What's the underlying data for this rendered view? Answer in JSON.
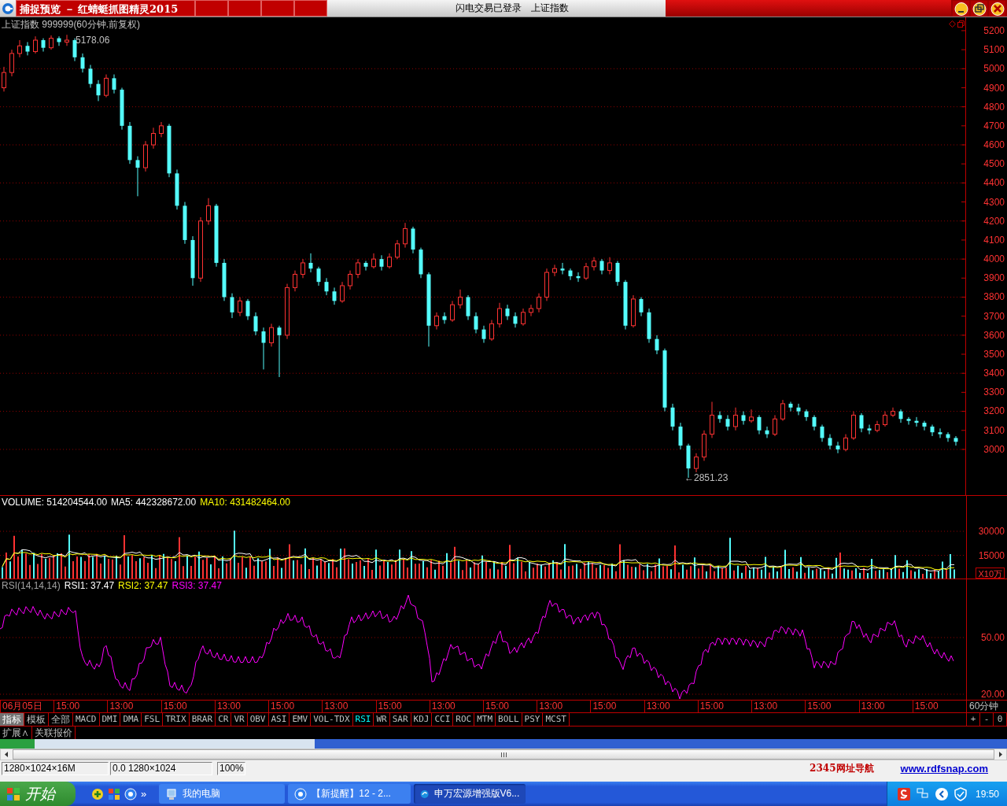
{
  "title_bar": {
    "title": "捕捉预览 － 红蜻蜓抓图精灵2015",
    "status": "闪电交易已登录",
    "symbol": "上证指数"
  },
  "price_panel": {
    "title": "上证指数 999999(60分钟.前复权)",
    "high_label": "5178.06",
    "low_label": "←2851.23",
    "chart_data": {
      "type": "candlestick",
      "ylim": [
        2760,
        5270
      ],
      "grid": true,
      "yticks": [
        {
          "value": 5200,
          "label": "5200"
        },
        {
          "value": 5100,
          "label": "5100"
        },
        {
          "value": 5000,
          "label": "5000"
        },
        {
          "value": 4900,
          "label": "4900"
        },
        {
          "value": 4800,
          "label": "4800"
        },
        {
          "value": 4700,
          "label": "4700"
        },
        {
          "value": 4600,
          "label": "4600"
        },
        {
          "value": 4500,
          "label": "4500"
        },
        {
          "value": 4400,
          "label": "4400"
        },
        {
          "value": 4300,
          "label": "4300"
        },
        {
          "value": 4200,
          "label": "4200"
        },
        {
          "value": 4100,
          "label": "4100"
        },
        {
          "value": 4000,
          "label": "4000"
        },
        {
          "value": 3900,
          "label": "3900"
        },
        {
          "value": 3800,
          "label": "3800"
        },
        {
          "value": 3700,
          "label": "3700"
        },
        {
          "value": 3600,
          "label": "3600"
        },
        {
          "value": 3500,
          "label": "3500"
        },
        {
          "value": 3400,
          "label": "3400"
        },
        {
          "value": 3300,
          "label": "3300"
        },
        {
          "value": 3200,
          "label": "3200"
        },
        {
          "value": 3100,
          "label": "3100"
        },
        {
          "value": 3000,
          "label": "3000"
        }
      ],
      "ohlc": [
        [
          4900,
          5010,
          4880,
          4980
        ],
        [
          4980,
          5100,
          4960,
          5080
        ],
        [
          5080,
          5150,
          5060,
          5120
        ],
        [
          5120,
          5140,
          5070,
          5090
        ],
        [
          5090,
          5170,
          5080,
          5150
        ],
        [
          5150,
          5160,
          5090,
          5110
        ],
        [
          5110,
          5175,
          5100,
          5160
        ],
        [
          5160,
          5170,
          5120,
          5140
        ],
        [
          5140,
          5178.06,
          5120,
          5150
        ],
        [
          5150,
          5160,
          5040,
          5060
        ],
        [
          5060,
          5080,
          4980,
          5000
        ],
        [
          5000,
          5020,
          4900,
          4920
        ],
        [
          4920,
          4940,
          4830,
          4860
        ],
        [
          4860,
          4970,
          4850,
          4950
        ],
        [
          4950,
          4970,
          4870,
          4890
        ],
        [
          4890,
          4900,
          4680,
          4700
        ],
        [
          4700,
          4720,
          4500,
          4520
        ],
        [
          4520,
          4540,
          4330,
          4480
        ],
        [
          4480,
          4620,
          4460,
          4600
        ],
        [
          4600,
          4690,
          4580,
          4660
        ],
        [
          4660,
          4720,
          4640,
          4700
        ],
        [
          4700,
          4710,
          4430,
          4450
        ],
        [
          4450,
          4470,
          4260,
          4280
        ],
        [
          4280,
          4300,
          4080,
          4100
        ],
        [
          4100,
          4120,
          3860,
          3900
        ],
        [
          3900,
          4220,
          3880,
          4200
        ],
        [
          4200,
          4320,
          4180,
          4280
        ],
        [
          4280,
          4290,
          3960,
          3980
        ],
        [
          3980,
          4000,
          3780,
          3800
        ],
        [
          3800,
          3820,
          3690,
          3720
        ],
        [
          3720,
          3800,
          3700,
          3780
        ],
        [
          3780,
          3790,
          3680,
          3700
        ],
        [
          3700,
          3720,
          3600,
          3620
        ],
        [
          3620,
          3640,
          3420,
          3560
        ],
        [
          3560,
          3660,
          3540,
          3640
        ],
        [
          3640,
          3650,
          3380,
          3600
        ],
        [
          3600,
          3870,
          3580,
          3850
        ],
        [
          3850,
          3940,
          3830,
          3920
        ],
        [
          3920,
          4000,
          3900,
          3980
        ],
        [
          3980,
          4030,
          3930,
          3950
        ],
        [
          3950,
          3960,
          3860,
          3880
        ],
        [
          3880,
          3900,
          3810,
          3830
        ],
        [
          3830,
          3850,
          3760,
          3780
        ],
        [
          3780,
          3880,
          3770,
          3860
        ],
        [
          3860,
          3940,
          3840,
          3920
        ],
        [
          3920,
          4000,
          3900,
          3980
        ],
        [
          3980,
          3990,
          3940,
          3960
        ],
        [
          3960,
          4030,
          3950,
          4000
        ],
        [
          4000,
          4020,
          3940,
          3960
        ],
        [
          3960,
          4030,
          3950,
          4010
        ],
        [
          4010,
          4100,
          4000,
          4080
        ],
        [
          4080,
          4190,
          4060,
          4160
        ],
        [
          4160,
          4170,
          4030,
          4050
        ],
        [
          4050,
          4060,
          3900,
          3920
        ],
        [
          3920,
          3930,
          3540,
          3650
        ],
        [
          3650,
          3720,
          3630,
          3700
        ],
        [
          3700,
          3720,
          3660,
          3680
        ],
        [
          3680,
          3780,
          3670,
          3760
        ],
        [
          3760,
          3840,
          3740,
          3800
        ],
        [
          3800,
          3810,
          3680,
          3700
        ],
        [
          3700,
          3720,
          3610,
          3630
        ],
        [
          3630,
          3650,
          3560,
          3580
        ],
        [
          3580,
          3680,
          3570,
          3660
        ],
        [
          3660,
          3770,
          3640,
          3740
        ],
        [
          3740,
          3760,
          3680,
          3700
        ],
        [
          3700,
          3720,
          3640,
          3660
        ],
        [
          3660,
          3740,
          3650,
          3720
        ],
        [
          3720,
          3760,
          3700,
          3740
        ],
        [
          3740,
          3820,
          3720,
          3800
        ],
        [
          3800,
          3950,
          3780,
          3930
        ],
        [
          3930,
          3970,
          3910,
          3950
        ],
        [
          3950,
          3980,
          3920,
          3940
        ],
        [
          3940,
          3950,
          3890,
          3910
        ],
        [
          3910,
          3930,
          3880,
          3900
        ],
        [
          3900,
          3980,
          3890,
          3960
        ],
        [
          3960,
          4010,
          3940,
          3990
        ],
        [
          3990,
          4000,
          3920,
          3940
        ],
        [
          3940,
          4010,
          3920,
          3980
        ],
        [
          3980,
          3990,
          3860,
          3880
        ],
        [
          3880,
          3890,
          3630,
          3650
        ],
        [
          3650,
          3810,
          3640,
          3790
        ],
        [
          3790,
          3800,
          3700,
          3720
        ],
        [
          3720,
          3740,
          3560,
          3580
        ],
        [
          3580,
          3600,
          3500,
          3520
        ],
        [
          3520,
          3530,
          3200,
          3220
        ],
        [
          3220,
          3240,
          3100,
          3120
        ],
        [
          3120,
          3140,
          3000,
          3020
        ],
        [
          3020,
          3030,
          2851.23,
          2900
        ],
        [
          2900,
          2980,
          2880,
          2960
        ],
        [
          2960,
          3100,
          2940,
          3080
        ],
        [
          3080,
          3250,
          3060,
          3180
        ],
        [
          3180,
          3200,
          3140,
          3160
        ],
        [
          3160,
          3180,
          3100,
          3120
        ],
        [
          3120,
          3220,
          3100,
          3180
        ],
        [
          3180,
          3200,
          3130,
          3150
        ],
        [
          3150,
          3210,
          3140,
          3170
        ],
        [
          3170,
          3180,
          3080,
          3100
        ],
        [
          3100,
          3120,
          3060,
          3080
        ],
        [
          3080,
          3180,
          3070,
          3160
        ],
        [
          3160,
          3260,
          3150,
          3240
        ],
        [
          3240,
          3250,
          3200,
          3220
        ],
        [
          3220,
          3240,
          3180,
          3200
        ],
        [
          3200,
          3210,
          3150,
          3170
        ],
        [
          3170,
          3180,
          3100,
          3120
        ],
        [
          3120,
          3130,
          3040,
          3060
        ],
        [
          3060,
          3080,
          3000,
          3020
        ],
        [
          3020,
          3040,
          2980,
          3000
        ],
        [
          3000,
          3080,
          2990,
          3060
        ],
        [
          3060,
          3200,
          3050,
          3180
        ],
        [
          3180,
          3190,
          3090,
          3110
        ],
        [
          3110,
          3130,
          3080,
          3100
        ],
        [
          3100,
          3150,
          3090,
          3130
        ],
        [
          3130,
          3200,
          3120,
          3180
        ],
        [
          3180,
          3220,
          3170,
          3200
        ],
        [
          3200,
          3210,
          3140,
          3160
        ],
        [
          3160,
          3170,
          3130,
          3150
        ],
        [
          3150,
          3170,
          3120,
          3140
        ],
        [
          3140,
          3150,
          3100,
          3120
        ],
        [
          3120,
          3130,
          3070,
          3090
        ],
        [
          3090,
          3110,
          3060,
          3080
        ],
        [
          3080,
          3090,
          3040,
          3060
        ],
        [
          3060,
          3070,
          3020,
          3040
        ]
      ]
    }
  },
  "volume_panel": {
    "labels": [
      {
        "text": "VOLUME: 514204544.00",
        "color": "#ffffff"
      },
      {
        "text": "MA5: 442328672.00",
        "color": "#ffffff"
      },
      {
        "text": "MA10: 431482464.00",
        "color": "#ffff00"
      }
    ],
    "axis_labels": [
      "30000",
      "15000"
    ],
    "unit": "X10万"
  },
  "rsi_panel": {
    "labels": [
      {
        "text": "RSI(14,14,14)",
        "color": "#a0a0a0"
      },
      {
        "text": "RSI1: 37.47",
        "color": "#ffffff"
      },
      {
        "text": "RSI2: 37.47",
        "color": "#ffff00"
      },
      {
        "text": "RSI3: 37.47",
        "color": "#ff00ff"
      }
    ],
    "axis_labels": [
      "50.00",
      "20.00"
    ]
  },
  "time_axis": {
    "labels": [
      "06月05日",
      "15:00",
      "13:00",
      "15:00",
      "13:00",
      "15:00",
      "13:00",
      "15:00",
      "13:00",
      "15:00",
      "13:00",
      "15:00",
      "13:00",
      "15:00",
      "13:00",
      "15:00",
      "13:00",
      "15:00"
    ],
    "period": "60分钟"
  },
  "modes": [
    {
      "label": "指标",
      "selected": true
    },
    {
      "label": "模板",
      "selected": false
    },
    {
      "label": "全部",
      "selected": false
    }
  ],
  "indicators": [
    {
      "label": "MACD",
      "selected": false
    },
    {
      "label": "DMI",
      "selected": false
    },
    {
      "label": "DMA",
      "selected": false
    },
    {
      "label": "FSL",
      "selected": false
    },
    {
      "label": "TRIX",
      "selected": false
    },
    {
      "label": "BRAR",
      "selected": false
    },
    {
      "label": "CR",
      "selected": false
    },
    {
      "label": "VR",
      "selected": false
    },
    {
      "label": "OBV",
      "selected": false
    },
    {
      "label": "ASI",
      "selected": false
    },
    {
      "label": "EMV",
      "selected": false
    },
    {
      "label": "VOL-TDX",
      "selected": false
    },
    {
      "label": "RSI",
      "selected": true
    },
    {
      "label": "WR",
      "selected": false
    },
    {
      "label": "SAR",
      "selected": false
    },
    {
      "label": "KDJ",
      "selected": false
    },
    {
      "label": "CCI",
      "selected": false
    },
    {
      "label": "ROC",
      "selected": false
    },
    {
      "label": "MTM",
      "selected": false
    },
    {
      "label": "BOLL",
      "selected": false
    },
    {
      "label": "PSY",
      "selected": false
    },
    {
      "label": "MCST",
      "selected": false
    }
  ],
  "zoom_buttons": [
    "+",
    "-",
    "0"
  ],
  "extra_tabs": [
    "扩展∧",
    "关联报价"
  ],
  "status_bar": {
    "cells": [
      "1280×1024×16M",
      "0.0 1280×1024",
      "100%"
    ],
    "links": [
      "2345网址导航",
      "www.rdfsnap.com"
    ]
  },
  "taskbar": {
    "start": "开始",
    "more": "»",
    "tasks": [
      {
        "label": "我的电脑",
        "selected": false
      },
      {
        "label": "【新提醒】12 - 2...",
        "selected": false
      },
      {
        "label": "申万宏源增强版V6...",
        "selected": true
      }
    ],
    "clock": "19:50"
  }
}
